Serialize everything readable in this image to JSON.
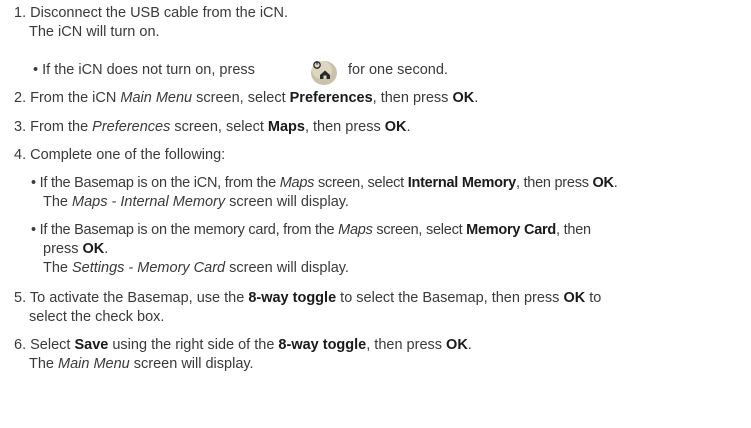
{
  "steps": {
    "s1": {
      "num": "1.",
      "text": "Disconnect the USB cable from the iCN.",
      "sub": "The iCN will turn on.",
      "bullet_pre": "If the iCN does not turn on, press",
      "bullet_post": "for one second."
    },
    "s2": {
      "num": "2.",
      "a": "From the iCN ",
      "b": "Main Menu",
      "c": " screen, select ",
      "d": "Preferences",
      "e": ", then press ",
      "f": "OK",
      "g": "."
    },
    "s3": {
      "num": "3.",
      "a": "From the ",
      "b": "Preferences",
      "c": " screen, select ",
      "d": "Maps",
      "e": ", then press ",
      "f": "OK",
      "g": "."
    },
    "s4": {
      "num": "4.",
      "text": "Complete one of the following:",
      "b1": {
        "a": "If the Basemap is on the iCN, from the ",
        "b": "Maps",
        "c": " screen, select ",
        "d": "Internal Memory",
        "e": ", then press ",
        "f": "OK",
        "g": ".",
        "sub_a": "The ",
        "sub_b": "Maps - Internal Memory",
        "sub_c": " screen will display."
      },
      "b2": {
        "a": "If the Basemap is on the memory card, from the ",
        "b": "Maps",
        "c": " screen, select ",
        "d": "Memory Card",
        "e": ", then",
        "l2a": "press ",
        "l2b": "OK",
        "l2c": ".",
        "sub_a": "The ",
        "sub_b": "Settings - Memory Card",
        "sub_c": " screen will display."
      }
    },
    "s5": {
      "num": "5.",
      "a": "To activate the Basemap, use the ",
      "b": "8-way toggle",
      "c": " to select the Basemap, then press ",
      "d": "OK",
      "e": " to",
      "l2": "select the check box."
    },
    "s6": {
      "num": "6.",
      "a": "Select ",
      "b": "Save",
      "c": " using the right side of the ",
      "d": "8-way toggle",
      "e": ", then press ",
      "f": "OK",
      "g": ".",
      "sub_a": "The ",
      "sub_b": "Main Menu",
      "sub_c": " screen will display."
    }
  },
  "icons": {
    "power_home_button": "power-home-button-icon"
  },
  "colors": {
    "text": "#3a3a3a",
    "bold": "#1a1a1a",
    "button_face": "#c9c1a8"
  }
}
